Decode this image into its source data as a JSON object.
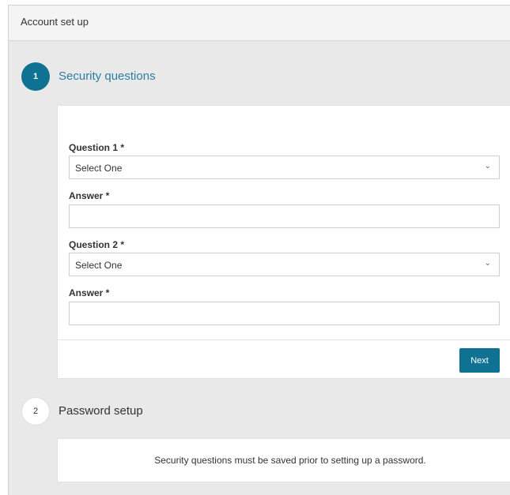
{
  "header": {
    "title": "Account set up"
  },
  "steps": [
    {
      "number": "1",
      "title": "Security questions",
      "state": "active"
    },
    {
      "number": "2",
      "title": "Password setup",
      "state": "inactive"
    }
  ],
  "form": {
    "question1": {
      "label": "Question 1 *",
      "selected": "Select One"
    },
    "answer1": {
      "label": "Answer *",
      "value": ""
    },
    "question2": {
      "label": "Question 2 *",
      "selected": "Select One"
    },
    "answer2": {
      "label": "Answer *",
      "value": ""
    },
    "next_label": "Next"
  },
  "password_note": "Security questions must be saved prior to setting up a password.",
  "icons": {
    "dropdown": "chevron-down-icon"
  },
  "colors": {
    "accent": "#0f7292",
    "active_title": "#2b7ea6",
    "background": "#e9e9e9"
  }
}
